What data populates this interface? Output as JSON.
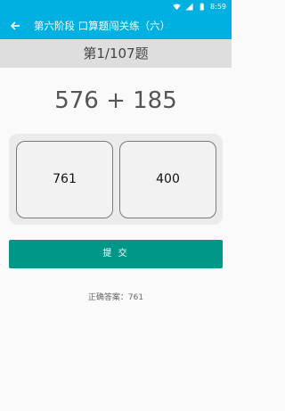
{
  "status_bar": {
    "time": "8:59",
    "icons": [
      "wifi-icon",
      "signal-icon",
      "battery-icon"
    ]
  },
  "app_bar": {
    "back_icon": "back-arrow-icon",
    "title": "第六阶段  口算题闯关练（六）"
  },
  "counter": "第1/107题",
  "question": "576 + 185",
  "options": [
    "761",
    "400"
  ],
  "submit_label": "提 交",
  "answer_label": "正确答案：",
  "answer_value": "761",
  "colors": {
    "primary": "#00b0e0",
    "button": "#009688",
    "counter_bg": "#dedede"
  }
}
